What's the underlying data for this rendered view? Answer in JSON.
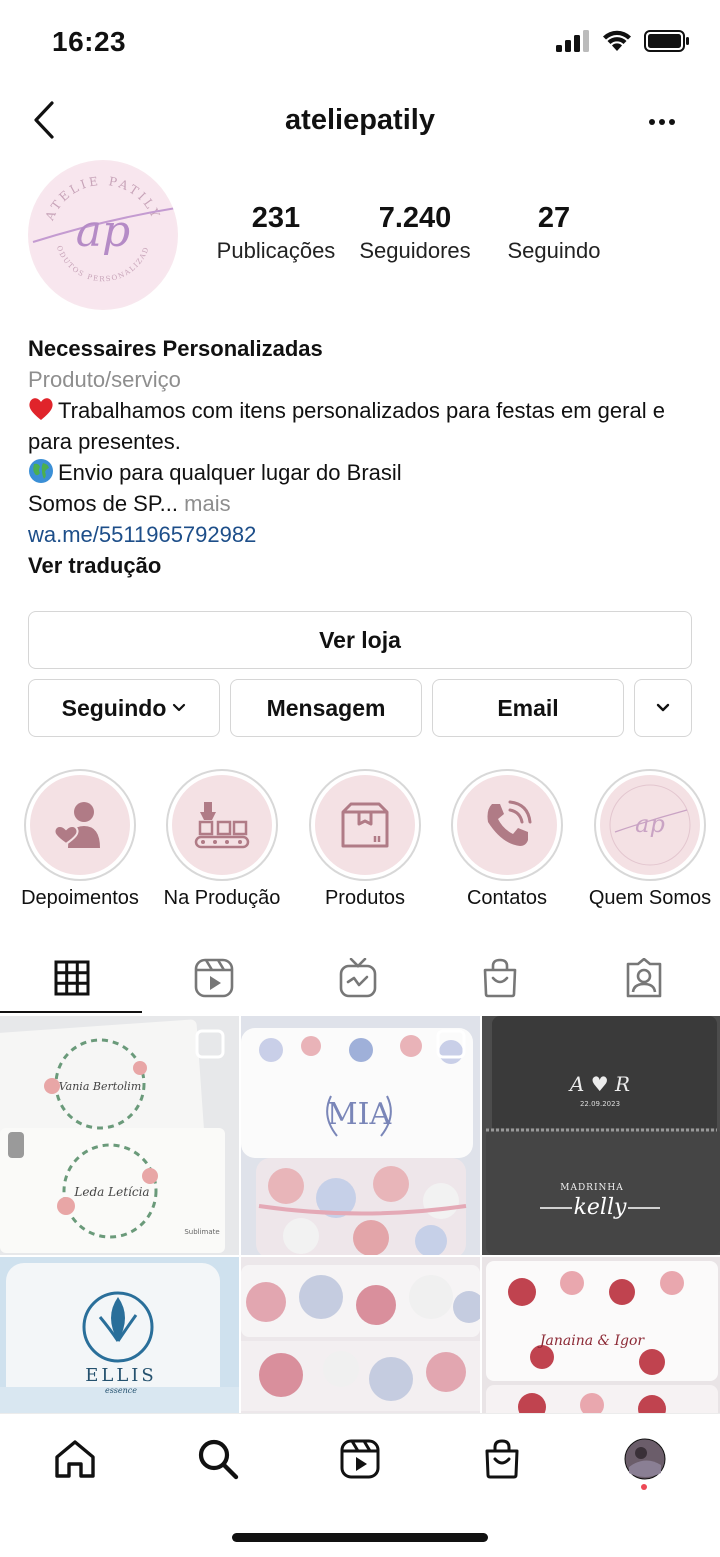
{
  "status_bar": {
    "time": "16:23",
    "icons": [
      "signal-icon",
      "wifi-icon",
      "battery-icon"
    ]
  },
  "header": {
    "username": "ateliepatily",
    "back_icon": "chevron-left-icon",
    "more_icon": "more-horizontal-icon"
  },
  "avatar": {
    "logo_text_top": "ATELIE PATILY",
    "logo_monogram": "ap",
    "logo_text_bottom": "PRODUTOS PERSONALIZADOS"
  },
  "stats": [
    {
      "value": "231",
      "label": "Publicações"
    },
    {
      "value": "7.240",
      "label": "Seguidores"
    },
    {
      "value": "27",
      "label": "Seguindo"
    }
  ],
  "bio": {
    "name": "Necessaires Personalizadas",
    "category": "Produto/serviço",
    "line1_emoji": "heart-emoji",
    "line1": "Trabalhamos com itens personalizados para festas em geral e para presentes.",
    "line2_emoji": "globe-emoji",
    "line2": "Envio para qualquer lugar do Brasil",
    "line3": "Somos de SP...",
    "more": "mais",
    "link": "wa.me/5511965792982",
    "translate": "Ver tradução"
  },
  "buttons": {
    "shop": "Ver loja",
    "following": "Seguindo",
    "message": "Mensagem",
    "email": "Email"
  },
  "highlights": [
    {
      "label": "Depoimentos",
      "icon": "person-heart-icon"
    },
    {
      "label": "Na Produção",
      "icon": "conveyor-icon"
    },
    {
      "label": "Produtos",
      "icon": "box-icon"
    },
    {
      "label": "Contatos",
      "icon": "phone-icon"
    },
    {
      "label": "Quem Somos",
      "icon": "logo-icon"
    }
  ],
  "tabs": [
    {
      "name": "grid-tab",
      "icon": "grid-icon",
      "active": true
    },
    {
      "name": "reels-tab",
      "icon": "reels-icon"
    },
    {
      "name": "igtv-tab",
      "icon": "igtv-icon"
    },
    {
      "name": "shop-tab",
      "icon": "shopping-bag-icon"
    },
    {
      "name": "tagged-tab",
      "icon": "tagged-person-icon"
    }
  ],
  "posts": [
    {
      "texts": [
        "Vania Bertolim",
        "Leda Letícia",
        "Sublimate"
      ]
    },
    {
      "texts": [
        "MIA"
      ]
    },
    {
      "texts": [
        "A ♥ R",
        "22.09.2023",
        "MADRINHA",
        "kelly"
      ]
    },
    {
      "texts": [
        "ELLIS",
        "essence"
      ]
    },
    {
      "texts": []
    },
    {
      "texts": [
        "Janaina & Igor"
      ]
    }
  ],
  "bottom_nav": [
    "home-icon",
    "search-icon",
    "reels-icon",
    "shop-icon",
    "profile-avatar"
  ],
  "colors": {
    "link": "#1d4e89",
    "muted": "#8e8e8e",
    "highlight_bg": "#f4e1e4",
    "highlight_icon": "#b07b86",
    "notification_dot": "#ed4956"
  }
}
